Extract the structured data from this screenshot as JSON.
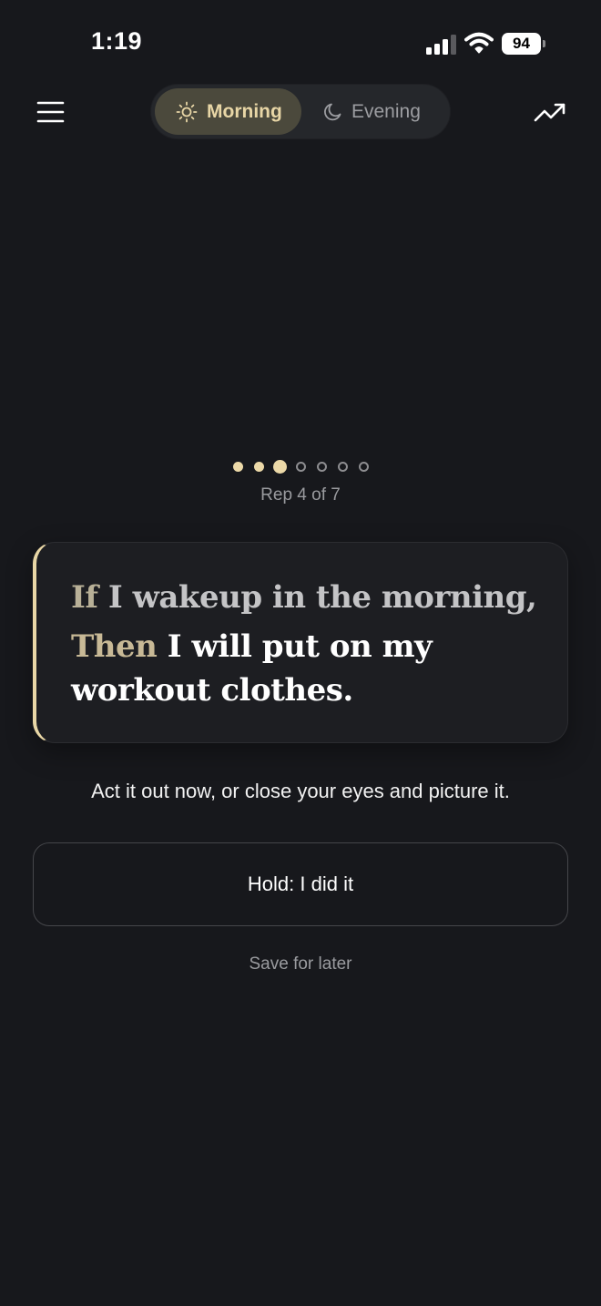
{
  "status_bar": {
    "time": "1:19",
    "battery_level": "94",
    "icons": [
      "cellular-signal-icon",
      "wifi-icon",
      "battery-icon"
    ]
  },
  "nav": {
    "menu_icon": "hamburger-menu-icon",
    "trend_icon": "trending-up-icon",
    "modes": [
      {
        "label": "Morning",
        "icon": "sun-icon",
        "selected": true
      },
      {
        "label": "Evening",
        "icon": "moon-icon",
        "selected": false
      }
    ]
  },
  "progress": {
    "current": 4,
    "total": 7,
    "label": "Rep 4 of 7"
  },
  "plan": {
    "if_keyword": "If",
    "if_text": " I wakeup in the morning,",
    "then_keyword": "Then",
    "then_text_line1": " I will put on my",
    "then_text_line2": "workout clothes."
  },
  "instruction": "Act it out now, or close your eyes and picture it.",
  "actions": {
    "hold_label": "Hold: I did it",
    "save_label": "Save for later"
  },
  "colors": {
    "background": "#17181c",
    "accent": "#e9d7a6",
    "card": "#1d1e22",
    "muted_text": "#9a9b9f"
  }
}
